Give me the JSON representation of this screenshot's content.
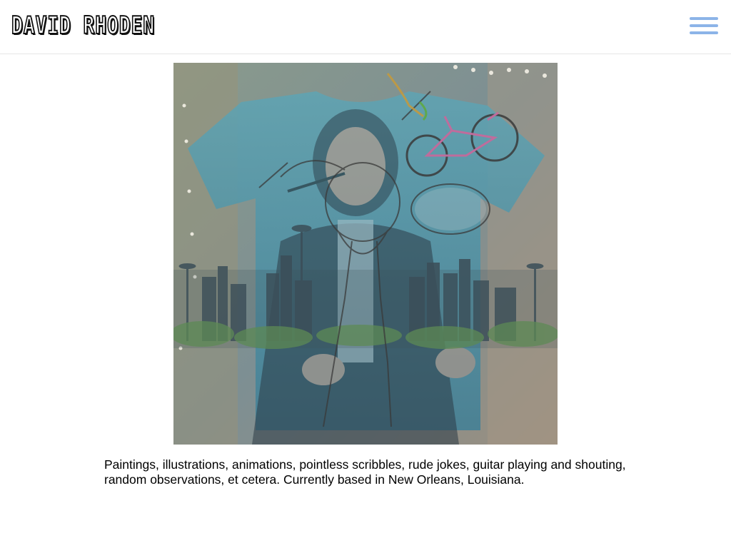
{
  "site": {
    "logo_text": "DAVID RHODEN",
    "menu_icon": "hamburger-menu-icon",
    "accent_color": "#8cb4e8"
  },
  "hero": {
    "description": "collage artwork"
  },
  "bio": {
    "text": "Paintings, illustrations, animations, pointless scribbles, rude jokes, guitar playing and shouting, random observations, et cetera. Currently based in New Orleans, Louisiana."
  }
}
